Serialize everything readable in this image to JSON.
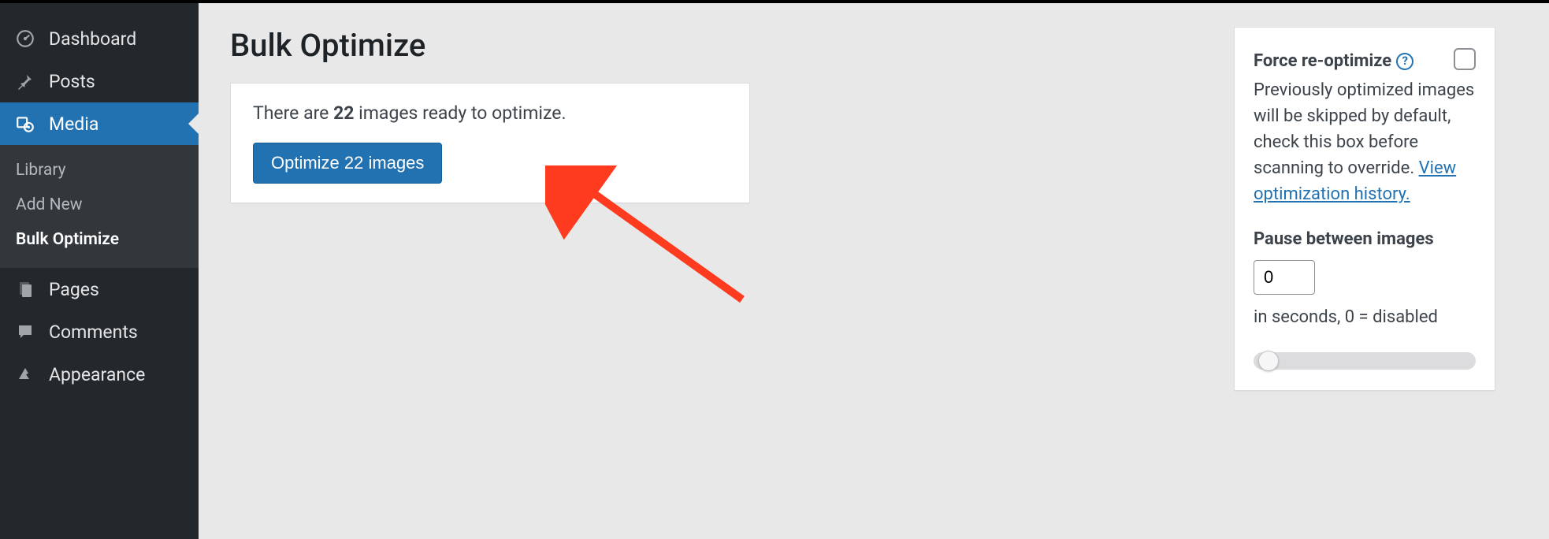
{
  "sidebar": {
    "dashboard": "Dashboard",
    "posts": "Posts",
    "media": "Media",
    "media_sub": {
      "library": "Library",
      "add_new": "Add New",
      "bulk_optimize": "Bulk Optimize"
    },
    "pages": "Pages",
    "comments": "Comments",
    "appearance": "Appearance"
  },
  "page": {
    "title": "Bulk Optimize",
    "status_pre": "There are ",
    "status_count": "22",
    "status_post": " images ready to optimize.",
    "optimize_btn": "Optimize 22 images"
  },
  "options": {
    "force_label": "Force re-optimize",
    "force_desc": " Previously optimized images will be skipped by default, check this box before scanning to override.  ",
    "history_link": "View optimization history.",
    "pause_label": "Pause between images",
    "pause_value": "0",
    "pause_unit": " in seconds, 0 = disabled"
  },
  "colors": {
    "accent": "#2271b1",
    "sidebar": "#23282d"
  }
}
